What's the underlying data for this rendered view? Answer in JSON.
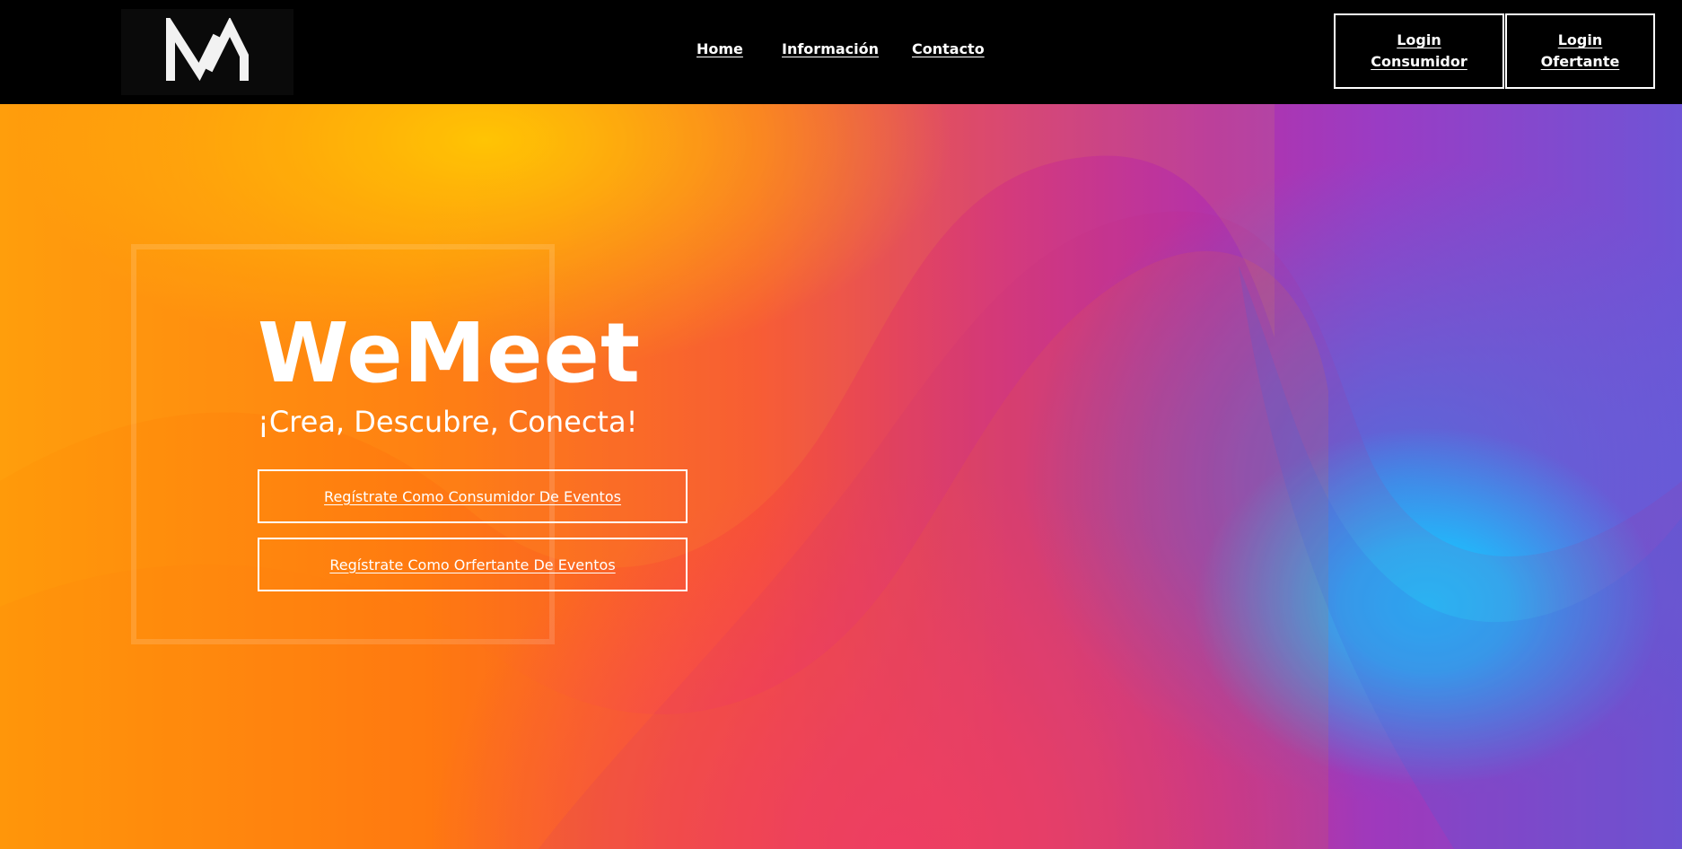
{
  "header": {
    "logo_icon": "wm-logo-icon",
    "nav": {
      "home": "Home",
      "info": "Información",
      "contact": "Contacto"
    },
    "login_consumer": {
      "line1": "Login",
      "line2": "Consumidor"
    },
    "login_offerer": {
      "line1": "Login",
      "line2": "Ofertante"
    }
  },
  "hero": {
    "title": "WeMeet",
    "subtitle": "¡Crea, Descubre, Conecta!",
    "cta_consumer": "Regístrate Como Consumidor De Eventos",
    "cta_offerer": "Regístrate Como Orfertante De Eventos"
  },
  "colors": {
    "header_bg": "#000000",
    "text": "#ffffff",
    "gradient_orange": "#ff8a00",
    "gradient_pink": "#e8356f",
    "gradient_purple": "#b024b8",
    "gradient_blue": "#19c3ff"
  }
}
